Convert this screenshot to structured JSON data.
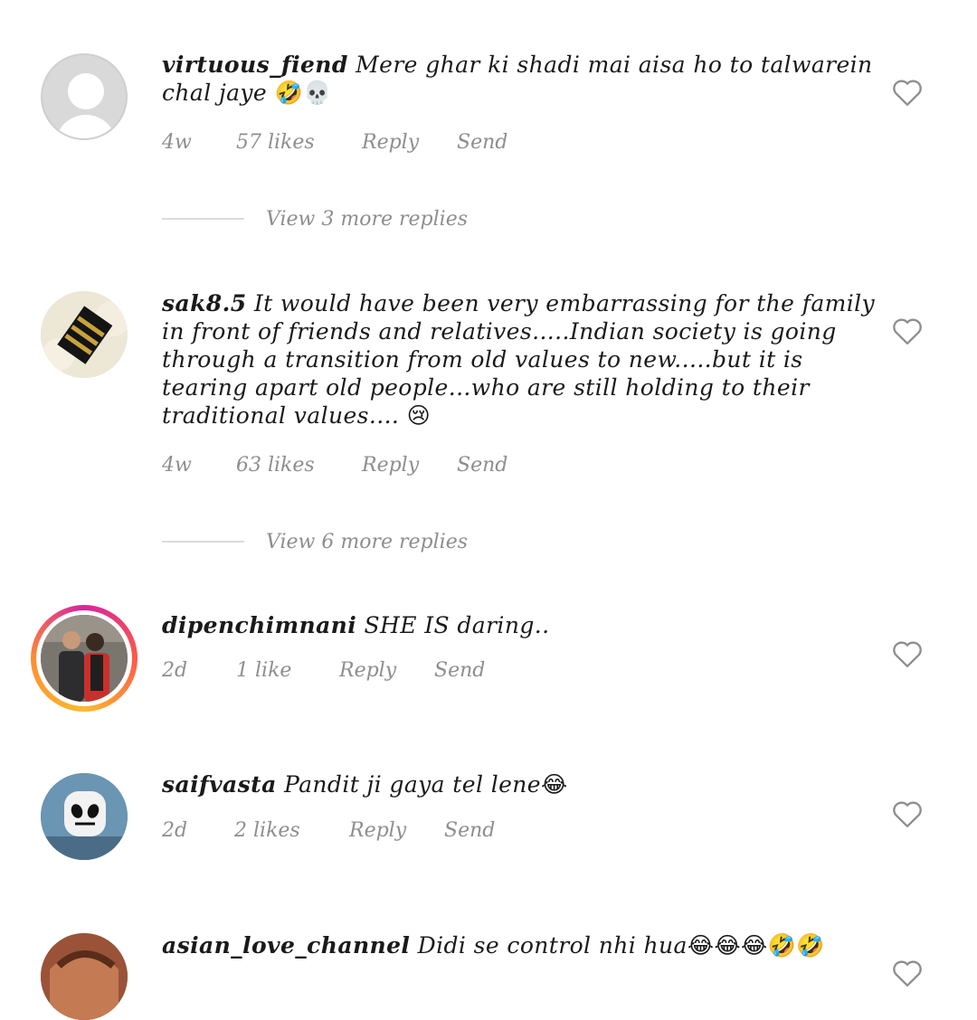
{
  "comments": [
    {
      "username": "virtuous_fiend",
      "text": "Mere ghar ki shadi mai aisa ho to talwarein chal jaye",
      "emojis": "🤣💀",
      "time": "4w",
      "likes": "57 likes",
      "reply": "Reply",
      "send": "Send",
      "view_replies": "View 3 more replies"
    },
    {
      "username": "sak8.5",
      "text": "It would have been very embarrassing for the family in front of friends and relatives.....Indian society is going through a transition from old values to new.....but it is tearing apart old people...who are still holding to their traditional values....",
      "emojis": "😢",
      "time": "4w",
      "likes": "63 likes",
      "reply": "Reply",
      "send": "Send",
      "view_replies": "View 6 more replies"
    },
    {
      "username": "dipenchimnani",
      "text": "SHE  IS daring..",
      "emojis": "",
      "time": "2d",
      "likes": "1 like",
      "reply": "Reply",
      "send": "Send"
    },
    {
      "username": "saifvasta",
      "text": "Pandit ji gaya tel lene",
      "emojis": "😂",
      "time": "2d",
      "likes": "2 likes",
      "reply": "Reply",
      "send": "Send"
    },
    {
      "username": "asian_love_channel",
      "text": "Didi se control nhi hua",
      "emojis": "😂😂😂🤣🤣",
      "time": "",
      "likes": "",
      "reply": "",
      "send": ""
    }
  ],
  "icons": {
    "heart": "heart-outline-icon",
    "avatar_default": "default-avatar-icon"
  },
  "colors": {
    "meta": "#8e8e8e",
    "text": "#1a1a1a",
    "divider": "#dbdbdb",
    "story_ring": "#d6249f"
  }
}
